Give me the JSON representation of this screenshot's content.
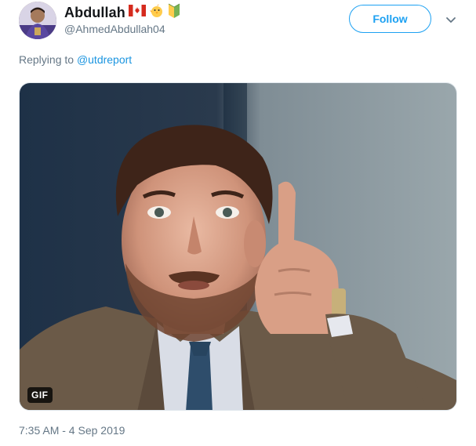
{
  "tweet": {
    "author": {
      "display_name": "Abdullah",
      "handle": "@AhmedAbdullah04",
      "badges": [
        "canada-flag-icon",
        "baby-chick-icon",
        "beginner-symbol-icon"
      ]
    },
    "follow_label": "Follow",
    "replying_prefix": "Replying to",
    "replying_mention": "@utdreport",
    "media": {
      "type": "gif",
      "badge_label": "GIF"
    },
    "timestamp": "7:35 AM - 4 Sep 2019"
  },
  "colors": {
    "accent": "#1da1f2",
    "link": "#1b95e0",
    "muted_text": "#657786",
    "primary_text": "#14171a"
  }
}
